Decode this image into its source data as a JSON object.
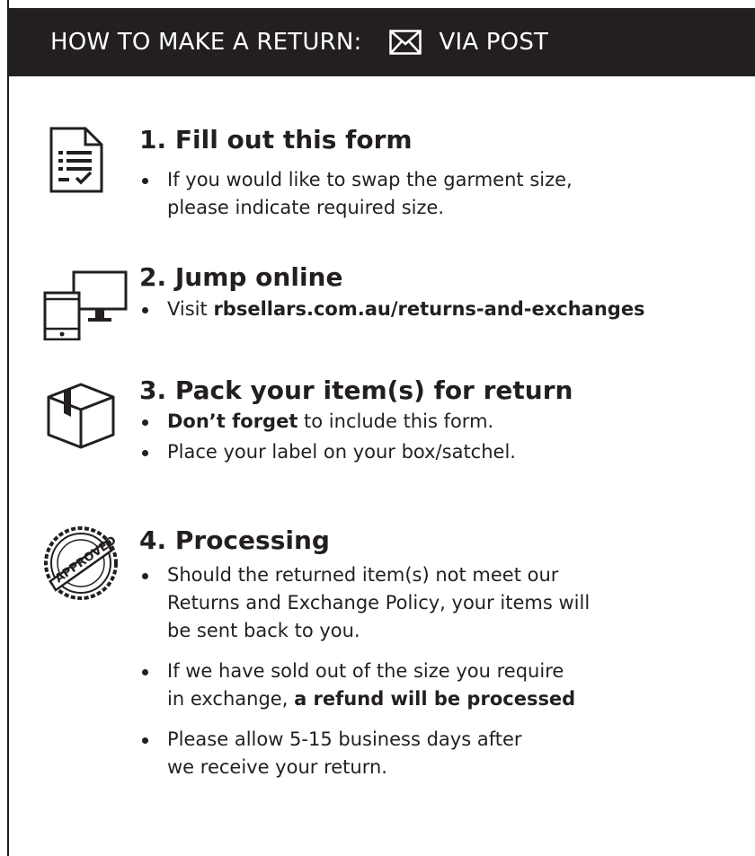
{
  "header": {
    "title_prefix": "HOW TO MAKE A RETURN:",
    "title_suffix": "VIA POST",
    "icon": "envelope-icon"
  },
  "steps": [
    {
      "icon": "checklist-form-icon",
      "title": "1. Fill out this form",
      "bullets": [
        {
          "line1": "If you would like to swap the garment size,",
          "line2": "please indicate required size."
        }
      ]
    },
    {
      "icon": "phone-monitor-icon",
      "title": "2. Jump online",
      "bullets": [
        {
          "prefix": "Visit ",
          "link": "rbsellars.com.au/returns-and-exchanges"
        }
      ]
    },
    {
      "icon": "box-icon",
      "title": "3. Pack your item(s) for return",
      "bullets": [
        {
          "bold": "Don’t forget",
          "rest": " to include this form."
        },
        {
          "text": "Place your label on your box/satchel."
        }
      ]
    },
    {
      "icon": "approved-stamp-icon",
      "stamp_text": "APPROVED",
      "title": "4. Processing",
      "bullets": [
        {
          "line1": "Should the returned item(s) not meet our",
          "line2": "Returns and Exchange Policy, your items will",
          "line3": "be sent back to you."
        },
        {
          "line1": "If we have sold out of the size you require",
          "line2_prefix": "in exchange, ",
          "line2_bold": "a refund will be processed"
        },
        {
          "line1": "Please allow 5-15 business days after",
          "line2": "we receive your return."
        }
      ]
    }
  ]
}
